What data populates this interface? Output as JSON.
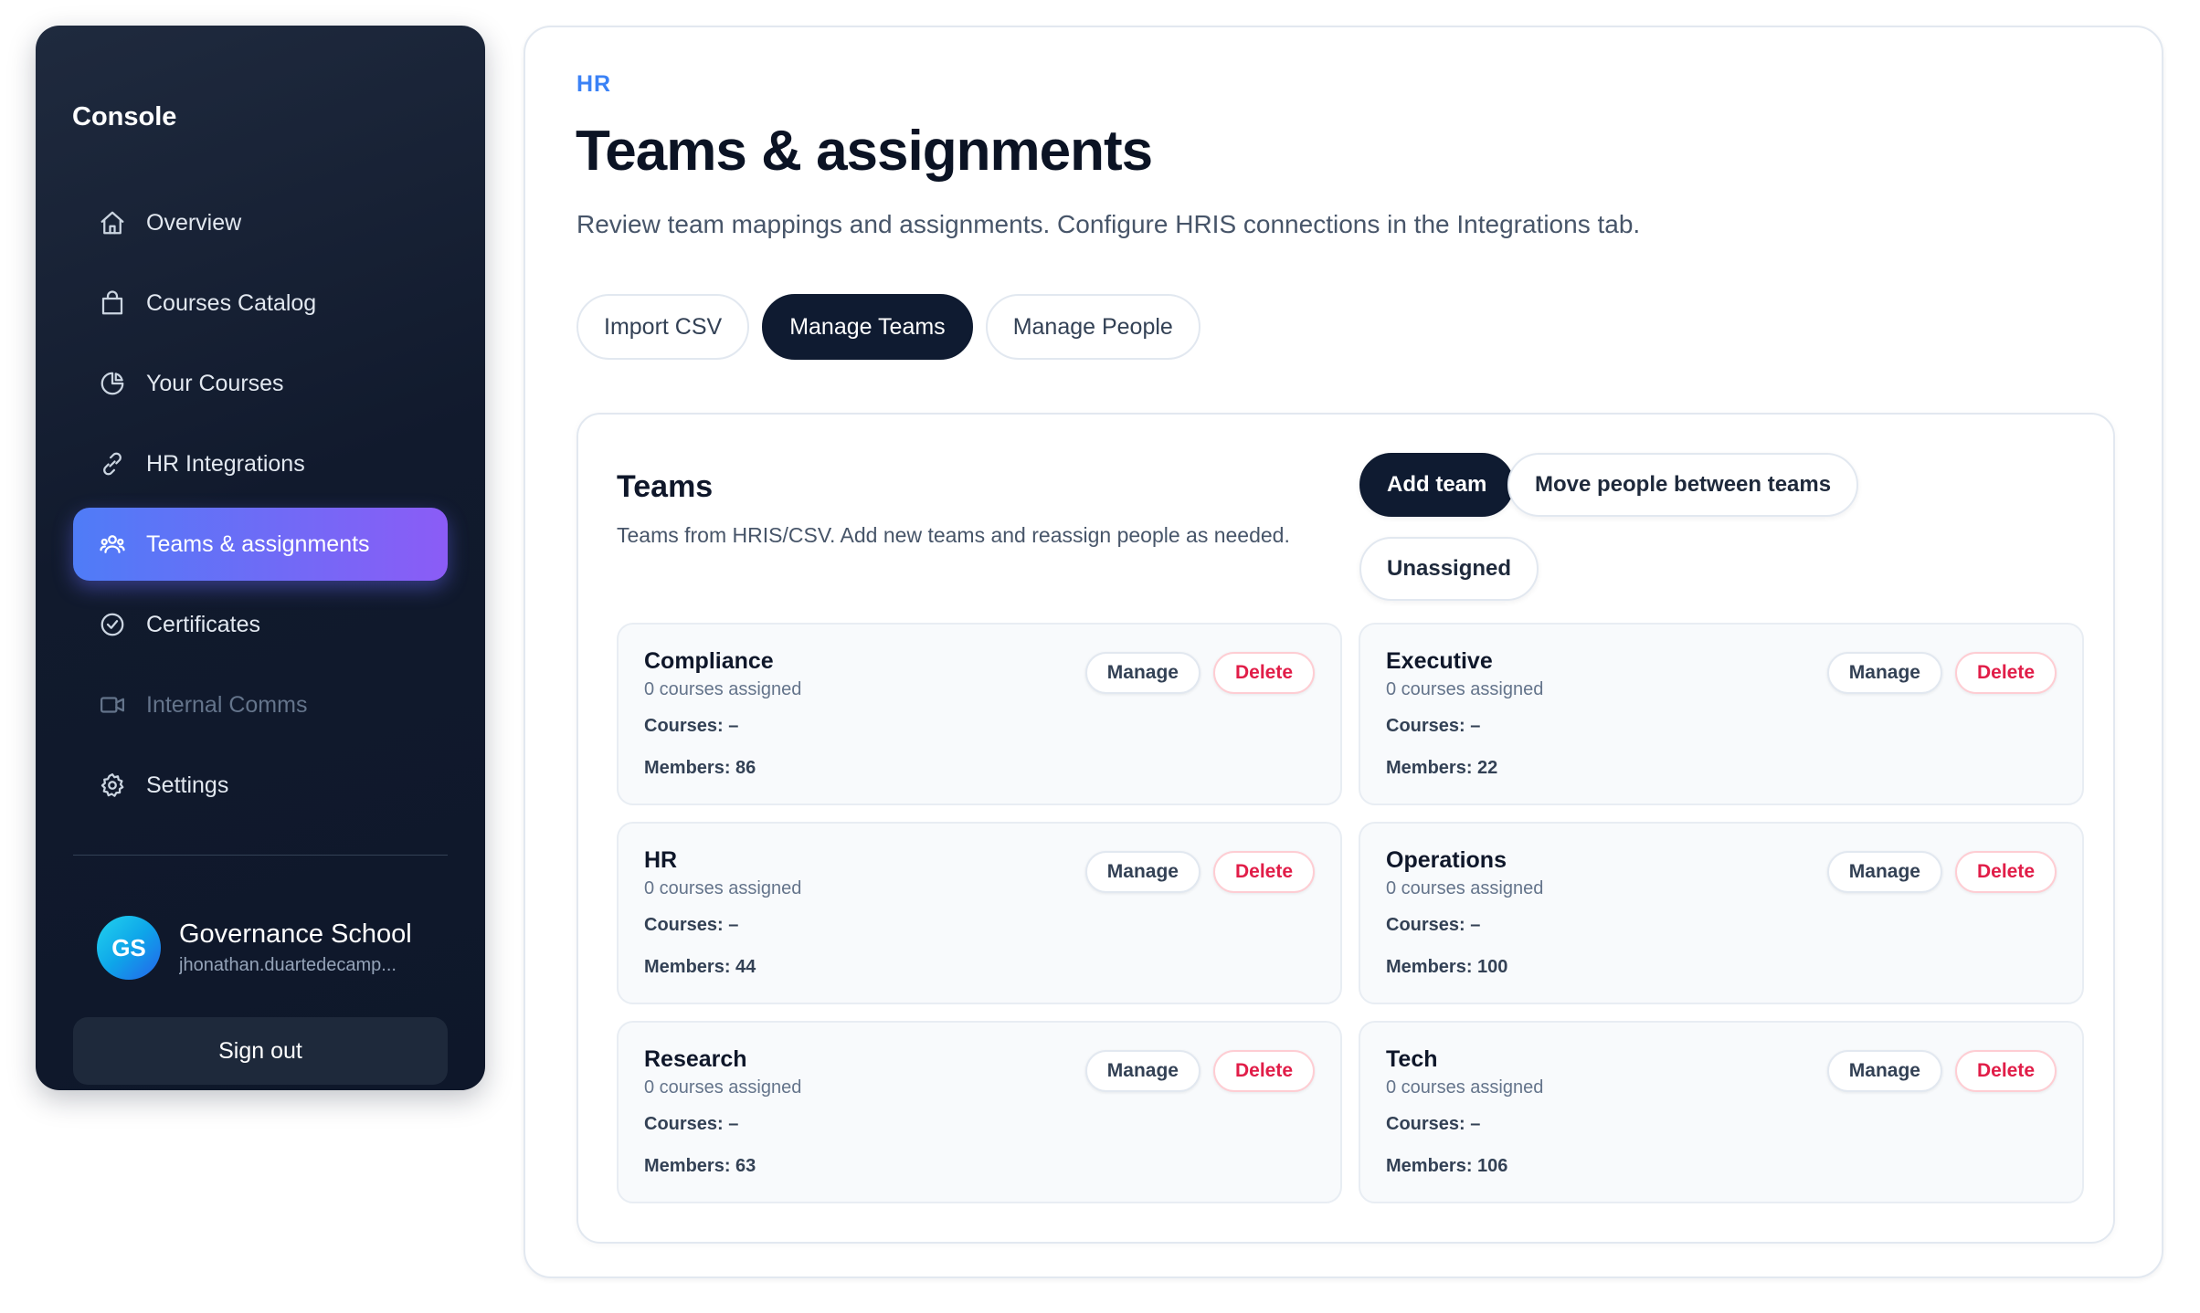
{
  "sidebar": {
    "title": "Console",
    "items": [
      {
        "label": "Overview",
        "icon": "home-icon"
      },
      {
        "label": "Courses Catalog",
        "icon": "shopping-bag-icon"
      },
      {
        "label": "Your Courses",
        "icon": "pie-chart-icon"
      },
      {
        "label": "HR Integrations",
        "icon": "link-icon"
      },
      {
        "label": "Teams & assignments",
        "icon": "users-icon",
        "active": true
      },
      {
        "label": "Certificates",
        "icon": "check-circle-icon"
      },
      {
        "label": "Internal Comms",
        "icon": "video-icon",
        "disabled": true
      },
      {
        "label": "Settings",
        "icon": "gear-icon"
      }
    ],
    "profile": {
      "initials": "GS",
      "name": "Governance School",
      "email": "jhonathan.duartedecamp..."
    },
    "sign_out_label": "Sign out"
  },
  "header": {
    "eyebrow": "HR",
    "title": "Teams & assignments",
    "description": "Review team mappings and assignments. Configure HRIS connections in the Integrations tab."
  },
  "tabs": [
    {
      "label": "Import CSV"
    },
    {
      "label": "Manage Teams",
      "active": true
    },
    {
      "label": "Manage People"
    }
  ],
  "teams_section": {
    "title": "Teams",
    "description": "Teams from HRIS/CSV. Add new teams and reassign people as needed.",
    "add_team_label": "Add team",
    "move_people_label": "Move people between teams",
    "unassigned_label": "Unassigned",
    "manage_label": "Manage",
    "delete_label": "Delete",
    "teams": [
      {
        "name": "Compliance",
        "assigned": "0 courses assigned",
        "courses": "Courses: –",
        "members": "Members: 86"
      },
      {
        "name": "Executive",
        "assigned": "0 courses assigned",
        "courses": "Courses: –",
        "members": "Members: 22"
      },
      {
        "name": "HR",
        "assigned": "0 courses assigned",
        "courses": "Courses: –",
        "members": "Members: 44"
      },
      {
        "name": "Operations",
        "assigned": "0 courses assigned",
        "courses": "Courses: –",
        "members": "Members: 100"
      },
      {
        "name": "Research",
        "assigned": "0 courses assigned",
        "courses": "Courses: –",
        "members": "Members: 63"
      },
      {
        "name": "Tech",
        "assigned": "0 courses assigned",
        "courses": "Courses: –",
        "members": "Members: 106"
      }
    ]
  },
  "colors": {
    "accent_gradient_start": "#4f7cf7",
    "accent_gradient_end": "#8b5cf6",
    "eyebrow_blue": "#3b82f6",
    "dark_button": "#0f1b31",
    "delete_red": "#e11d48"
  }
}
